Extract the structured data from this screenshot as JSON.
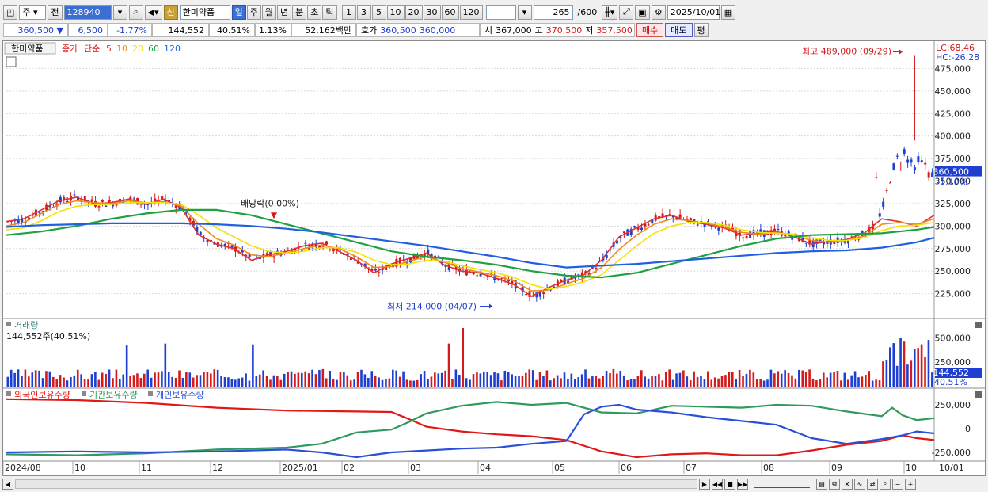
{
  "toolbar": {
    "market_select": "주",
    "prev_label": "전",
    "code": "128940",
    "credit_badge": "신",
    "stock_name": "한미약품",
    "periods": [
      "일",
      "주",
      "월",
      "년",
      "분",
      "초",
      "틱"
    ],
    "active_period": "일",
    "intervals": [
      "1",
      "3",
      "5",
      "10",
      "20",
      "30",
      "60",
      "120"
    ],
    "count": "265",
    "count_max": "/600",
    "date": "2025/10/01"
  },
  "quote": {
    "price": "360,500",
    "change": "6,500",
    "change_pct": "-1.77%",
    "volume": "144,552",
    "volume_ratio": "40.51%",
    "turnover_rate": "1.13%",
    "amount": "52,162백만",
    "ask_label": "호가",
    "ask1": "360,500",
    "ask2": "360,000",
    "open_label": "시",
    "open": "367,000",
    "high_label": "고",
    "high": "370,500",
    "low_label": "저",
    "low": "357,500",
    "buy_label": "매수",
    "sell_label": "매도",
    "avg_label": "평"
  },
  "colors": {
    "up": "#d41a1a",
    "down": "#1e3fd0",
    "ma5": "#e03030",
    "ma10": "#f08a20",
    "ma20": "#f3e200",
    "ma60": "#20a040",
    "ma120": "#2060e0",
    "foreign": "#e01818",
    "institution": "#2f9a5a",
    "individual": "#2a4fd8"
  },
  "chart_data": [
    {
      "type": "line",
      "title": "한미약품",
      "legend": [
        "종가",
        "단순",
        "5",
        "10",
        "20",
        "60",
        "120"
      ],
      "ylim": [
        200000,
        500000
      ],
      "y_ticks": [
        "475,000",
        "450,000",
        "425,000",
        "400,000",
        "375,000",
        "350,000",
        "325,000",
        "300,000",
        "275,000",
        "250,000",
        "225,000"
      ],
      "x_ticks": [
        "2024/08",
        "10",
        "11",
        "12",
        "2025/01",
        "02",
        "03",
        "04",
        "05",
        "06",
        "07",
        "08",
        "09",
        "10",
        "10/01"
      ],
      "lc_label": "LC:68.46",
      "hc_label": "HC:-26.28",
      "last_price_label": "360,500",
      "last_change_label": "-1.10%",
      "annotations": {
        "high": "최고 489,000 (09/29)",
        "low": "최저 214,000 (04/07)",
        "dividend": "배당락(0.00%)"
      },
      "series": [
        {
          "name": "5",
          "x": [
            0,
            5,
            10,
            15,
            20,
            25,
            30,
            35,
            40,
            45,
            50,
            55,
            60,
            65,
            70,
            75,
            80,
            85,
            90,
            95,
            100,
            105,
            110,
            115,
            120,
            125,
            130,
            135,
            140,
            145,
            150,
            155,
            160,
            165,
            170,
            175,
            180,
            185,
            190,
            195,
            200,
            205,
            210,
            215,
            220,
            225,
            230,
            235,
            240,
            245,
            250,
            255,
            260,
            265
          ],
          "values": [
            305000,
            308000,
            318000,
            328000,
            332000,
            325000,
            326000,
            330000,
            324000,
            330000,
            320000,
            290000,
            280000,
            275000,
            262000,
            268000,
            272000,
            278000,
            281000,
            272000,
            262000,
            248000,
            258000,
            264000,
            270000,
            257000,
            250000,
            248000,
            242000,
            235000,
            222000,
            232000,
            240000,
            246000,
            262000,
            288000,
            298000,
            308000,
            312000,
            305000,
            302000,
            298000,
            290000,
            292000,
            294000,
            288000,
            280000,
            283000,
            285000,
            292000,
            308000,
            305000,
            300000,
            312000
          ]
        },
        {
          "name": "10",
          "x": [
            0,
            5,
            10,
            15,
            20,
            25,
            30,
            35,
            40,
            45,
            50,
            55,
            60,
            65,
            70,
            75,
            80,
            85,
            90,
            95,
            100,
            105,
            110,
            115,
            120,
            125,
            130,
            135,
            140,
            145,
            150,
            155,
            160,
            165,
            170,
            175,
            180,
            185,
            190,
            195,
            200,
            205,
            210,
            215,
            220,
            225,
            230,
            235,
            240,
            245,
            250,
            255,
            260,
            265
          ],
          "values": [
            300000,
            304000,
            314000,
            324000,
            328000,
            326000,
            325000,
            328000,
            326000,
            327000,
            322000,
            302000,
            286000,
            279000,
            268000,
            266000,
            270000,
            275000,
            279000,
            275000,
            266000,
            254000,
            255000,
            261000,
            266000,
            260000,
            253000,
            249000,
            245000,
            239000,
            228000,
            229000,
            236000,
            242000,
            254000,
            274000,
            290000,
            302000,
            308000,
            306000,
            303000,
            299000,
            293000,
            291000,
            293000,
            290000,
            284000,
            282000,
            284000,
            289000,
            302000,
            304000,
            302000,
            308000
          ]
        },
        {
          "name": "20",
          "x": [
            0,
            5,
            10,
            15,
            20,
            25,
            30,
            35,
            40,
            45,
            50,
            55,
            60,
            65,
            70,
            75,
            80,
            85,
            90,
            95,
            100,
            105,
            110,
            115,
            120,
            125,
            130,
            135,
            140,
            145,
            150,
            155,
            160,
            165,
            170,
            175,
            180,
            185,
            190,
            195,
            200,
            205,
            210,
            215,
            220,
            225,
            230,
            235,
            240,
            245,
            250,
            255,
            260,
            265
          ],
          "values": [
            296000,
            298000,
            306000,
            316000,
            322000,
            324000,
            324000,
            326000,
            326000,
            326000,
            324000,
            312000,
            298000,
            288000,
            278000,
            272000,
            270000,
            272000,
            276000,
            276000,
            271000,
            262000,
            257000,
            258000,
            262000,
            261000,
            256000,
            252000,
            248000,
            243000,
            235000,
            230000,
            233000,
            238000,
            246000,
            262000,
            278000,
            292000,
            300000,
            304000,
            304000,
            301000,
            296000,
            293000,
            292000,
            291000,
            287000,
            284000,
            284000,
            287000,
            295000,
            300000,
            301000,
            304000
          ]
        },
        {
          "name": "60",
          "x": [
            0,
            10,
            20,
            30,
            40,
            50,
            60,
            70,
            80,
            90,
            100,
            110,
            120,
            130,
            140,
            150,
            160,
            170,
            180,
            190,
            200,
            210,
            220,
            230,
            240,
            250,
            260,
            265
          ],
          "values": [
            290000,
            294000,
            300000,
            308000,
            314000,
            318000,
            318000,
            312000,
            302000,
            292000,
            282000,
            272000,
            266000,
            262000,
            257000,
            250000,
            245000,
            243000,
            248000,
            258000,
            268000,
            278000,
            286000,
            290000,
            291000,
            292000,
            296000,
            299000
          ]
        },
        {
          "name": "120",
          "x": [
            0,
            10,
            20,
            30,
            40,
            50,
            60,
            70,
            80,
            90,
            100,
            110,
            120,
            130,
            140,
            150,
            160,
            170,
            180,
            190,
            200,
            210,
            220,
            230,
            240,
            250,
            260,
            265
          ],
          "values": [
            299000,
            301000,
            302000,
            303000,
            303000,
            303000,
            302000,
            300000,
            297000,
            293000,
            288000,
            283000,
            278000,
            272000,
            266000,
            259000,
            254000,
            256000,
            258000,
            261000,
            264000,
            267000,
            270000,
            272000,
            273000,
            276000,
            282000,
            287000
          ]
        }
      ]
    },
    {
      "type": "bar",
      "title": "거래량",
      "value_label": "144,552주(40.51%)",
      "y_ticks": [
        "500,000",
        "250,000"
      ],
      "last_label": "144,552",
      "last_ratio_label": "40.51%"
    },
    {
      "type": "line",
      "legend": [
        "외국인보유수량",
        "기관보유수량",
        "개인보유수량"
      ],
      "y_ticks": [
        "250,000",
        "0",
        "-250,000"
      ],
      "series": [
        {
          "name": "외국인보유수량",
          "x": [
            0,
            20,
            40,
            60,
            80,
            100,
            110,
            115,
            120,
            130,
            140,
            150,
            160,
            170,
            180,
            190,
            200,
            210,
            220,
            230,
            240,
            250,
            256,
            260,
            265
          ],
          "values": [
            310000,
            300000,
            270000,
            220000,
            190000,
            180000,
            175000,
            100000,
            20000,
            -30000,
            -60000,
            -80000,
            -120000,
            -240000,
            -300000,
            -270000,
            -260000,
            -280000,
            -280000,
            -230000,
            -170000,
            -130000,
            -70000,
            -100000,
            -120000
          ]
        },
        {
          "name": "기관보유수량",
          "x": [
            0,
            20,
            40,
            60,
            80,
            90,
            100,
            110,
            115,
            120,
            130,
            140,
            150,
            160,
            170,
            180,
            190,
            200,
            210,
            220,
            230,
            240,
            250,
            253,
            256,
            260,
            265
          ],
          "values": [
            -270000,
            -280000,
            -260000,
            -220000,
            -200000,
            -160000,
            -40000,
            -10000,
            70000,
            160000,
            240000,
            280000,
            250000,
            270000,
            170000,
            160000,
            240000,
            230000,
            220000,
            250000,
            240000,
            180000,
            130000,
            220000,
            140000,
            90000,
            110000
          ]
        },
        {
          "name": "개인보유수량",
          "x": [
            0,
            20,
            40,
            60,
            80,
            90,
            100,
            110,
            120,
            130,
            140,
            150,
            160,
            165,
            170,
            175,
            180,
            190,
            200,
            210,
            220,
            230,
            240,
            250,
            256,
            260,
            265
          ],
          "values": [
            -250000,
            -240000,
            -250000,
            -240000,
            -220000,
            -250000,
            -300000,
            -250000,
            -230000,
            -210000,
            -200000,
            -160000,
            -130000,
            150000,
            230000,
            250000,
            200000,
            170000,
            120000,
            80000,
            40000,
            -100000,
            -160000,
            -110000,
            -70000,
            -30000,
            -50000
          ]
        }
      ]
    }
  ]
}
